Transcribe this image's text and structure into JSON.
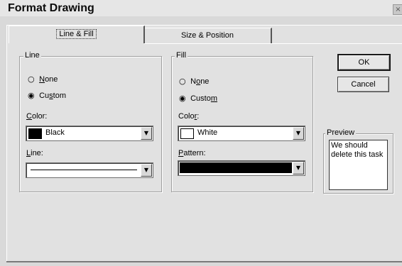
{
  "window": {
    "title": "Format Drawing",
    "close_glyph": "×"
  },
  "tabs": [
    {
      "label": "Line & Fill",
      "active": true
    },
    {
      "label": "Size & Position",
      "active": false
    }
  ],
  "line_group": {
    "legend": "Line",
    "option_none": {
      "pre": "",
      "key": "N",
      "post": "one",
      "selected": false
    },
    "option_custom": {
      "pre": "Cu",
      "key": "s",
      "post": "tom",
      "selected": true
    },
    "color_label": {
      "pre": "",
      "key": "C",
      "post": "olor:"
    },
    "color_value": "Black",
    "color_swatch": "#000000",
    "line_label": {
      "pre": "",
      "key": "L",
      "post": "ine:"
    }
  },
  "fill_group": {
    "legend": "Fill",
    "option_none": {
      "pre": "N",
      "key": "o",
      "post": "ne",
      "selected": false
    },
    "option_custom": {
      "pre": "Custo",
      "key": "m",
      "post": "",
      "selected": true
    },
    "color_label": {
      "pre": "Colo",
      "key": "r",
      "post": ":"
    },
    "color_value": "White",
    "color_swatch": "#ffffff",
    "pattern_label": {
      "pre": "",
      "key": "P",
      "post": "attern:"
    }
  },
  "buttons": {
    "ok": "OK",
    "cancel": "Cancel"
  },
  "preview": {
    "legend": "Preview",
    "text": "We should delete this task"
  },
  "icons": {
    "radio_selected": "◉",
    "radio_empty": "○",
    "dropdown": "▼"
  }
}
